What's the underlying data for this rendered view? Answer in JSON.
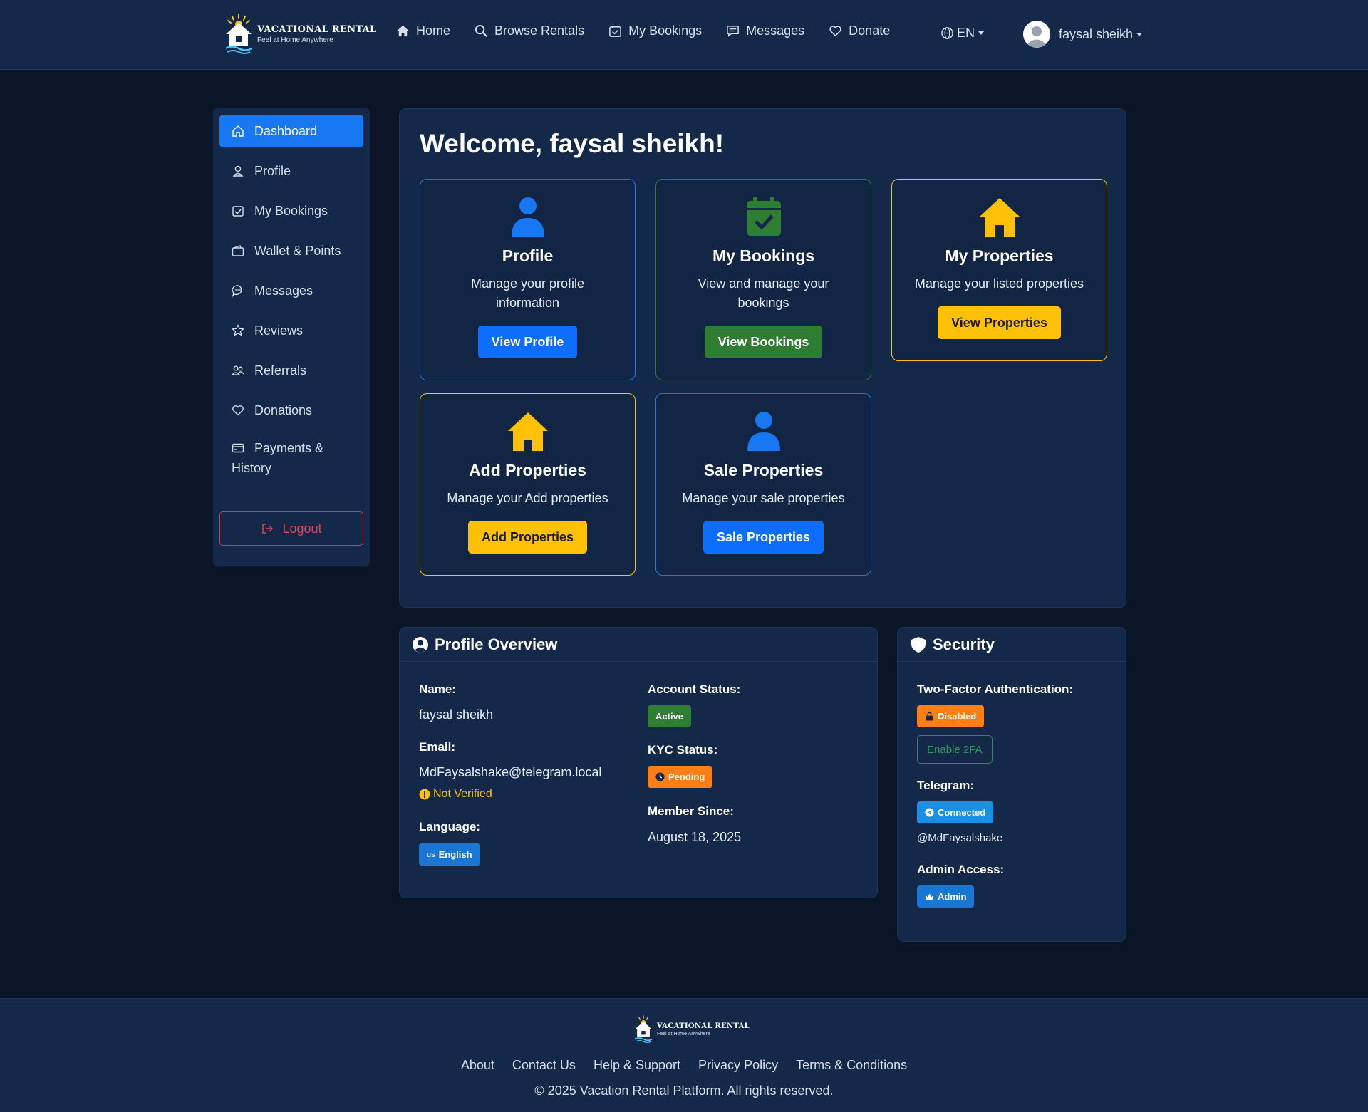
{
  "brand": {
    "title": "VACATIONAL RENTAL",
    "tagline": "Feel at Home Anywhere"
  },
  "nav": {
    "home": "Home",
    "browse": "Browse Rentals",
    "bookings": "My Bookings",
    "messages": "Messages",
    "donate": "Donate",
    "language": "EN",
    "user_name": "faysal sheikh"
  },
  "sidebar": {
    "items": [
      {
        "label": "Dashboard",
        "icon": "home-icon",
        "active": true
      },
      {
        "label": "Profile",
        "icon": "user-icon"
      },
      {
        "label": "My Bookings",
        "icon": "calendar-check-icon"
      },
      {
        "label": "Wallet & Points",
        "icon": "wallet-icon"
      },
      {
        "label": "Messages",
        "icon": "chat-icon"
      },
      {
        "label": "Reviews",
        "icon": "star-icon"
      },
      {
        "label": "Referrals",
        "icon": "people-icon"
      },
      {
        "label": "Donations",
        "icon": "heart-icon"
      },
      {
        "label_line1": "Payments &",
        "label_line2": "History",
        "icon": "credit-card-icon"
      }
    ],
    "logout": "Logout"
  },
  "welcome": "Welcome, faysal sheikh!",
  "cards": [
    {
      "title": "Profile",
      "desc": "Manage your profile information",
      "button": "View Profile",
      "icon": "person-icon",
      "color": "#1877f2"
    },
    {
      "title": "My Bookings",
      "desc": "View and manage your bookings",
      "button": "View Bookings",
      "icon": "calendar-check-icon",
      "color": "#2e7d32"
    },
    {
      "title": "My Properties",
      "desc": "Manage your listed properties",
      "button": "View Properties",
      "icon": "house-icon",
      "color": "#ffc107"
    },
    {
      "title": "Add Properties",
      "desc": "Manage your Add properties",
      "button": "Add Properties",
      "icon": "house-icon",
      "color": "#ffc107"
    },
    {
      "title": "Sale Properties",
      "desc": "Manage your sale properties",
      "button": "Sale Properties",
      "icon": "person-icon",
      "color": "#1877f2"
    }
  ],
  "profile_overview": {
    "heading": "Profile Overview",
    "name_label": "Name:",
    "name": "faysal sheikh",
    "email_label": "Email:",
    "email": "MdFaysalshake@telegram.local",
    "email_status": "Not Verified",
    "language_label": "Language:",
    "language_flag": "us",
    "language": "English",
    "account_status_label": "Account Status:",
    "account_status": "Active",
    "kyc_label": "KYC Status:",
    "kyc_status": "Pending",
    "member_since_label": "Member Since:",
    "member_since": "August 18, 2025"
  },
  "security": {
    "heading": "Security",
    "twofa_label": "Two-Factor Authentication:",
    "twofa_status": "Disabled",
    "enable_2fa": "Enable 2FA",
    "telegram_label": "Telegram:",
    "telegram_status": "Connected",
    "telegram_handle": "@MdFaysalshake",
    "admin_label": "Admin Access:",
    "admin_badge": "Admin"
  },
  "footer": {
    "links": [
      "About",
      "Contact Us",
      "Help & Support",
      "Privacy Policy",
      "Terms & Conditions"
    ],
    "copyright": "© 2025 Vacation Rental Platform. All rights reserved."
  },
  "colors": {
    "page_bg": "#0a1628",
    "panel_bg": "#14294a",
    "primary": "#1877f2",
    "success": "#2e7d32",
    "warning": "#ffc107",
    "orange": "#fd7e14",
    "danger": "#dc3545"
  }
}
